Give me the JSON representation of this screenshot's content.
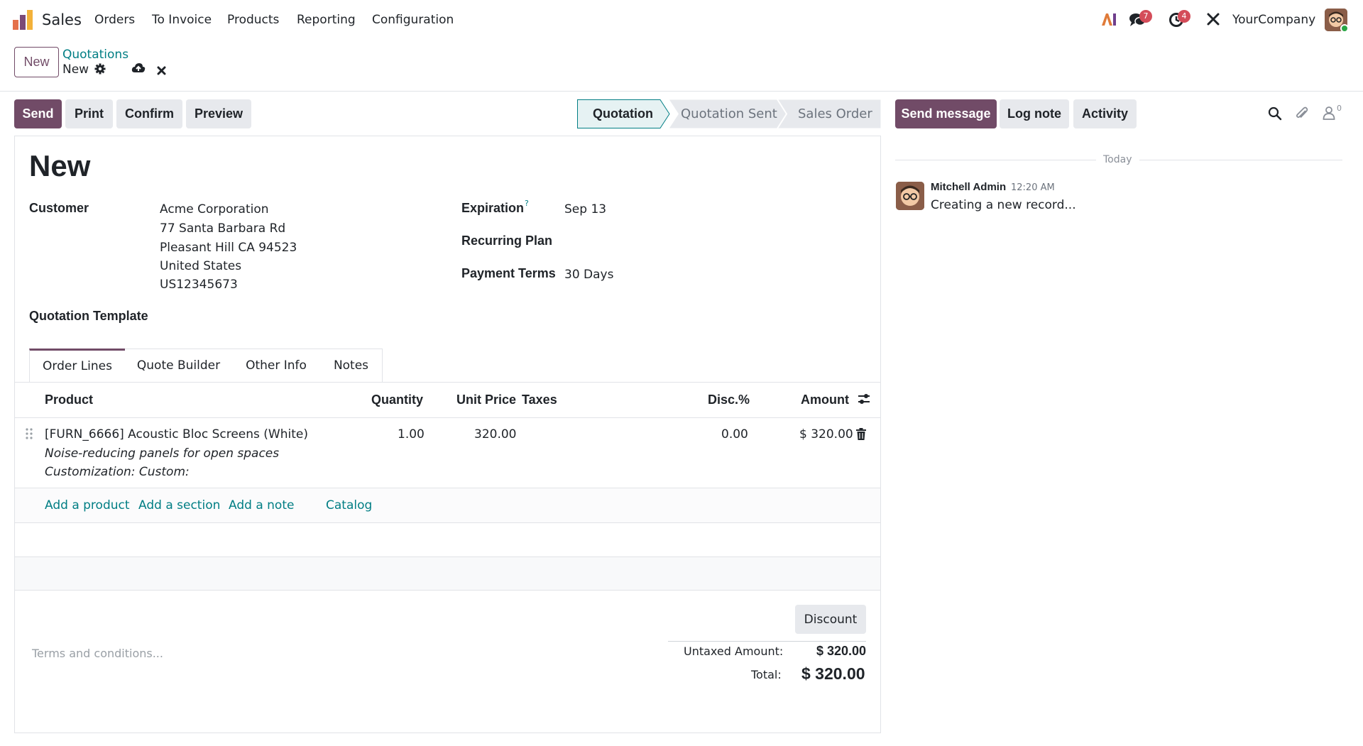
{
  "app": {
    "name": "Sales"
  },
  "menu": [
    "Orders",
    "To Invoice",
    "Products",
    "Reporting",
    "Configuration"
  ],
  "topbar": {
    "messages_badge": "7",
    "activities_badge": "4",
    "company": "YourCompany"
  },
  "control": {
    "new_label": "New",
    "breadcrumb_parent": "Quotations",
    "breadcrumb_current": "New"
  },
  "actions": {
    "send": "Send",
    "print": "Print",
    "confirm": "Confirm",
    "preview": "Preview"
  },
  "statusbar": {
    "steps": [
      "Quotation",
      "Quotation Sent",
      "Sales Order"
    ],
    "active": "Quotation"
  },
  "form": {
    "title": "New",
    "customer_label": "Customer",
    "customer_lines": [
      "Acme Corporation",
      "77 Santa Barbara Rd",
      "Pleasant Hill CA 94523",
      "United States",
      "US12345673"
    ],
    "expiration_label": "Expiration",
    "expiration_help": "?",
    "expiration_value": "Sep 13",
    "recurring_label": "Recurring Plan",
    "payment_terms_label": "Payment Terms",
    "payment_terms_value": "30 Days",
    "template_label": "Quotation Template"
  },
  "tabs": [
    "Order Lines",
    "Quote Builder",
    "Other Info",
    "Notes"
  ],
  "table": {
    "headers": {
      "product": "Product",
      "quantity": "Quantity",
      "unit_price": "Unit Price",
      "taxes": "Taxes",
      "disc": "Disc.%",
      "amount": "Amount"
    },
    "rows": [
      {
        "product": "[FURN_6666] Acoustic Bloc Screens (White)",
        "description1": "Noise-reducing panels for open spaces",
        "description2": "Customization: Custom:",
        "quantity": "1.00",
        "unit_price": "320.00",
        "taxes": "",
        "disc": "0.00",
        "amount": "$ 320.00"
      }
    ],
    "add_links": {
      "product": "Add a product",
      "section": "Add a section",
      "note": "Add a note",
      "catalog": "Catalog"
    }
  },
  "footer": {
    "discount": "Discount",
    "terms_placeholder": "Terms and conditions...",
    "untaxed_label": "Untaxed Amount:",
    "untaxed_value": "$ 320.00",
    "total_label": "Total:",
    "total_value": "$ 320.00"
  },
  "chatter": {
    "send_message": "Send message",
    "log_note": "Log note",
    "activity": "Activity",
    "followers_count": "0",
    "today": "Today",
    "message": {
      "author": "Mitchell Admin",
      "time": "12:20 AM",
      "body": "Creating a new record..."
    }
  },
  "colors": {
    "brand": "#714b67",
    "link": "#017e84",
    "badge": "#d44c59"
  }
}
